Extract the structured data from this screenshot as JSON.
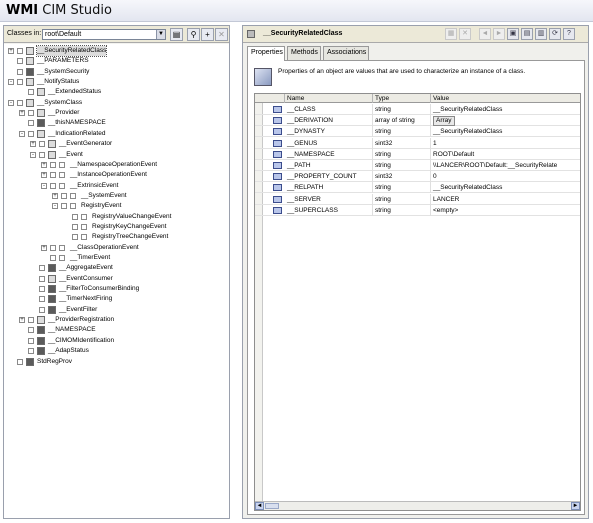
{
  "window": {
    "title_bold": "WMI",
    "title_rest": " CIM Studio"
  },
  "left_toolbar": {
    "classes_label": "Classes in:",
    "namespace_value": "root\\Default"
  },
  "tree": [
    {
      "label": "__SecurityRelatedClass",
      "level": 0,
      "expander": "+",
      "icon": "light",
      "selected": true
    },
    {
      "label": "__PARAMETERS",
      "level": 0,
      "expander": "",
      "icon": "light"
    },
    {
      "label": "__SystemSecurity",
      "level": 0,
      "expander": "",
      "icon": "dark"
    },
    {
      "label": "__NotifyStatus",
      "level": 0,
      "expander": "-",
      "icon": "light"
    },
    {
      "label": "__ExtendedStatus",
      "level": 1,
      "expander": "",
      "icon": "light"
    },
    {
      "label": "__SystemClass",
      "level": 0,
      "expander": "-",
      "icon": "light"
    },
    {
      "label": "__Provider",
      "level": 1,
      "expander": "+",
      "icon": "light"
    },
    {
      "label": "__thisNAMESPACE",
      "level": 1,
      "expander": "",
      "icon": "dark"
    },
    {
      "label": "__IndicationRelated",
      "level": 1,
      "expander": "-",
      "icon": "light"
    },
    {
      "label": "__EventGenerator",
      "level": 2,
      "expander": "+",
      "icon": "light"
    },
    {
      "label": "__Event",
      "level": 2,
      "expander": "-",
      "icon": "light"
    },
    {
      "label": "__NamespaceOperationEvent",
      "level": 3,
      "expander": "+",
      "icon": "none"
    },
    {
      "label": "__InstanceOperationEvent",
      "level": 3,
      "expander": "+",
      "icon": "none"
    },
    {
      "label": "__ExtrinsicEvent",
      "level": 3,
      "expander": "-",
      "icon": "none"
    },
    {
      "label": "__SystemEvent",
      "level": 4,
      "expander": "+",
      "icon": "none"
    },
    {
      "label": "RegistryEvent",
      "level": 4,
      "expander": "-",
      "icon": "none"
    },
    {
      "label": "RegistryValueChangeEvent",
      "level": 5,
      "expander": "",
      "icon": "none"
    },
    {
      "label": "RegistryKeyChangeEvent",
      "level": 5,
      "expander": "",
      "icon": "none"
    },
    {
      "label": "RegistryTreeChangeEvent",
      "level": 5,
      "expander": "",
      "icon": "none"
    },
    {
      "label": "__ClassOperationEvent",
      "level": 3,
      "expander": "+",
      "icon": "none"
    },
    {
      "label": "__TimerEvent",
      "level": 3,
      "expander": "",
      "icon": "none"
    },
    {
      "label": "__AggregateEvent",
      "level": 2,
      "expander": "",
      "icon": "dark"
    },
    {
      "label": "__EventConsumer",
      "level": 2,
      "expander": "",
      "icon": "light"
    },
    {
      "label": "__FilterToConsumerBinding",
      "level": 2,
      "expander": "",
      "icon": "dark"
    },
    {
      "label": "__TimerNextFiring",
      "level": 2,
      "expander": "",
      "icon": "dark"
    },
    {
      "label": "__EventFilter",
      "level": 2,
      "expander": "",
      "icon": "dark"
    },
    {
      "label": "__ProviderRegistration",
      "level": 1,
      "expander": "+",
      "icon": "light"
    },
    {
      "label": "__NAMESPACE",
      "level": 1,
      "expander": "",
      "icon": "dark"
    },
    {
      "label": "__CIMOMIdentification",
      "level": 1,
      "expander": "",
      "icon": "dark"
    },
    {
      "label": "__AdapStatus",
      "level": 1,
      "expander": "",
      "icon": "dark"
    },
    {
      "label": "StdRegProv",
      "level": 0,
      "expander": "",
      "icon": "dark"
    }
  ],
  "right_header": {
    "class_name": "__SecurityRelatedClass"
  },
  "tabs": [
    {
      "label": "Properties"
    },
    {
      "label": "Methods"
    },
    {
      "label": "Associations"
    }
  ],
  "properties_description": "Properties of an object are values that are used to characterize an instance of a class.",
  "grid": {
    "columns": [
      "Name",
      "Type",
      "Value"
    ],
    "rows": [
      {
        "name": "__CLASS",
        "type": "string",
        "value": "__SecurityRelatedClass"
      },
      {
        "name": "__DERIVATION",
        "type": "array of string",
        "value": "Array"
      },
      {
        "name": "__DYNASTY",
        "type": "string",
        "value": "__SecurityRelatedClass"
      },
      {
        "name": "__GENUS",
        "type": "sint32",
        "value": "1"
      },
      {
        "name": "__NAMESPACE",
        "type": "string",
        "value": "ROOT\\Default"
      },
      {
        "name": "__PATH",
        "type": "string",
        "value": "\\\\LANCER\\ROOT\\Default:__SecurityRelate"
      },
      {
        "name": "__PROPERTY_COUNT",
        "type": "sint32",
        "value": "0"
      },
      {
        "name": "__RELPATH",
        "type": "string",
        "value": "__SecurityRelatedClass"
      },
      {
        "name": "__SERVER",
        "type": "string",
        "value": "LANCER"
      },
      {
        "name": "__SUPERCLASS",
        "type": "string",
        "value": "<empty>"
      }
    ]
  }
}
